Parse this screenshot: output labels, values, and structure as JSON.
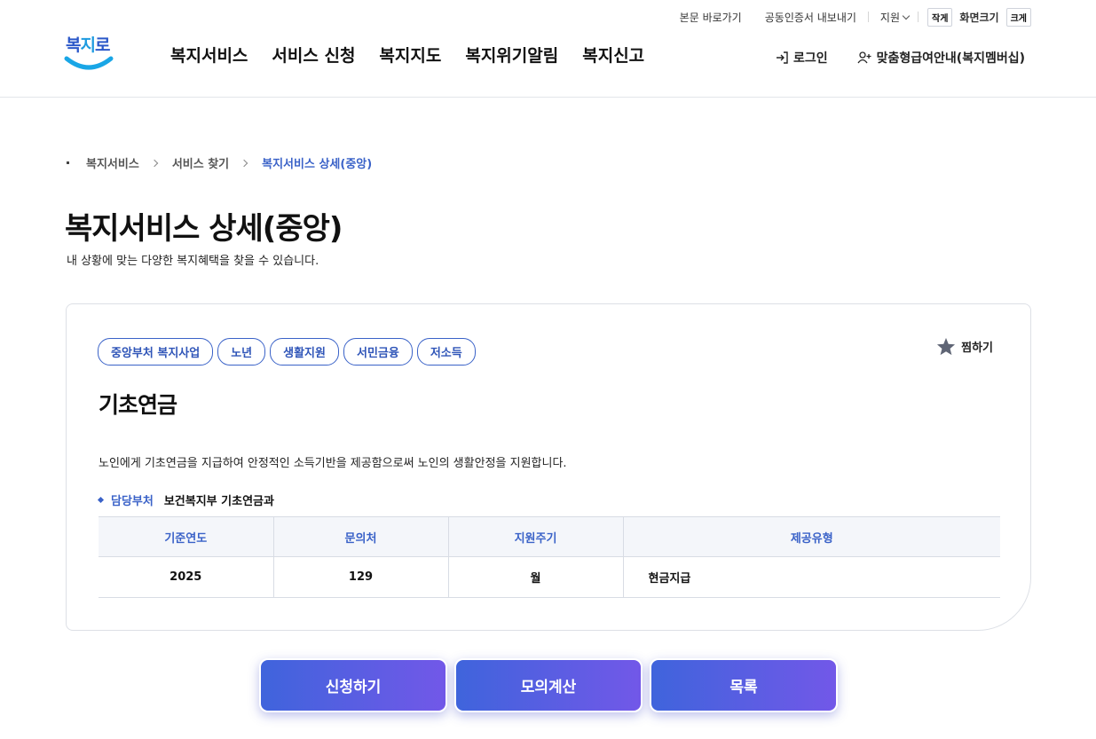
{
  "brand": {
    "logo_text_a": "복",
    "logo_text_b": "지",
    "logo_text_c": "로"
  },
  "utility": {
    "skip_link": "본문 바로가기",
    "cert_export": "공동인증서 내보내기",
    "language": "지원",
    "font_small": "작게",
    "font_label": "화면크기",
    "font_large": "크게"
  },
  "gnb": [
    "복지서비스",
    "서비스 신청",
    "복지지도",
    "복지위기알림",
    "복지신고"
  ],
  "header_right": {
    "login": "로그인",
    "membership": "맞춤형급여안내(복지멤버십)"
  },
  "breadcrumb": [
    "복지서비스",
    "서비스 찾기",
    "복지서비스 상세(중앙)"
  ],
  "page": {
    "title": "복지서비스 상세(중앙)",
    "subtitle": "내 상황에 맞는 다양한 복지혜택을 찾을 수 있습니다."
  },
  "service": {
    "tags": [
      "중앙부처 복지사업",
      "노년",
      "생활지원",
      "서민금융",
      "저소득"
    ],
    "favorite_label": "찜하기",
    "title": "기초연금",
    "description": "노인에게 기초연금을 지급하여 안정적인 소득기반을 제공함으로써 노인의 생활안정을 지원합니다.",
    "dept_label": "담당부처",
    "dept_value": "보건복지부 기초연금과",
    "table": {
      "headers": [
        "기준연도",
        "문의처",
        "지원주기",
        "제공유형"
      ],
      "row": [
        "2025",
        "129",
        "월",
        "현금지급"
      ]
    }
  },
  "actions": {
    "apply": "신청하기",
    "simulate": "모의계산",
    "list": "목록"
  },
  "colors": {
    "accent": "#3a62c8",
    "button_start": "#3f64dc",
    "button_end": "#7258e8"
  }
}
